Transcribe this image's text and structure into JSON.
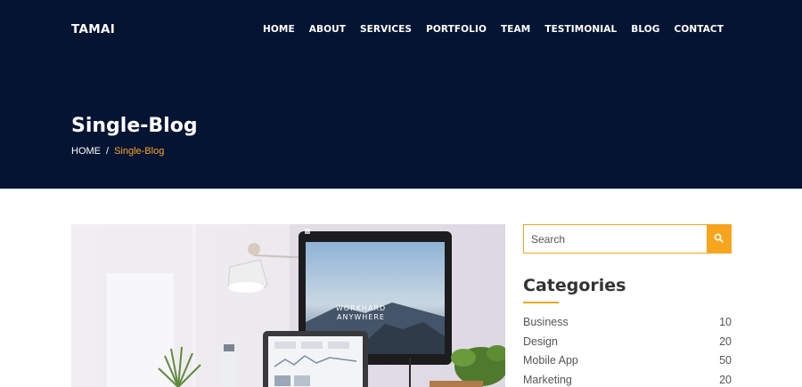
{
  "brand": "TAMAI",
  "nav": [
    "HOME",
    "ABOUT",
    "SERVICES",
    "PORTFOLIO",
    "TEAM",
    "TESTIMONIAL",
    "BLOG",
    "CONTACT"
  ],
  "hero": {
    "title": "Single-Blog",
    "breadcrumb": {
      "home": "HOME",
      "separator": "/",
      "current": "Single-Blog"
    }
  },
  "blog": {
    "image_text": [
      "WORKHARD",
      "ANYWHERE"
    ]
  },
  "sidebar": {
    "search": {
      "placeholder": "Search",
      "icon": "search-icon"
    },
    "categories_title": "Categories",
    "categories": [
      {
        "name": "Business",
        "count": "10"
      },
      {
        "name": "Design",
        "count": "20"
      },
      {
        "name": "Mobile App",
        "count": "50"
      },
      {
        "name": "Marketing",
        "count": "20"
      }
    ]
  },
  "colors": {
    "hero_bg": "#061434",
    "accent": "#f7a51e",
    "text_dark": "#333333"
  }
}
